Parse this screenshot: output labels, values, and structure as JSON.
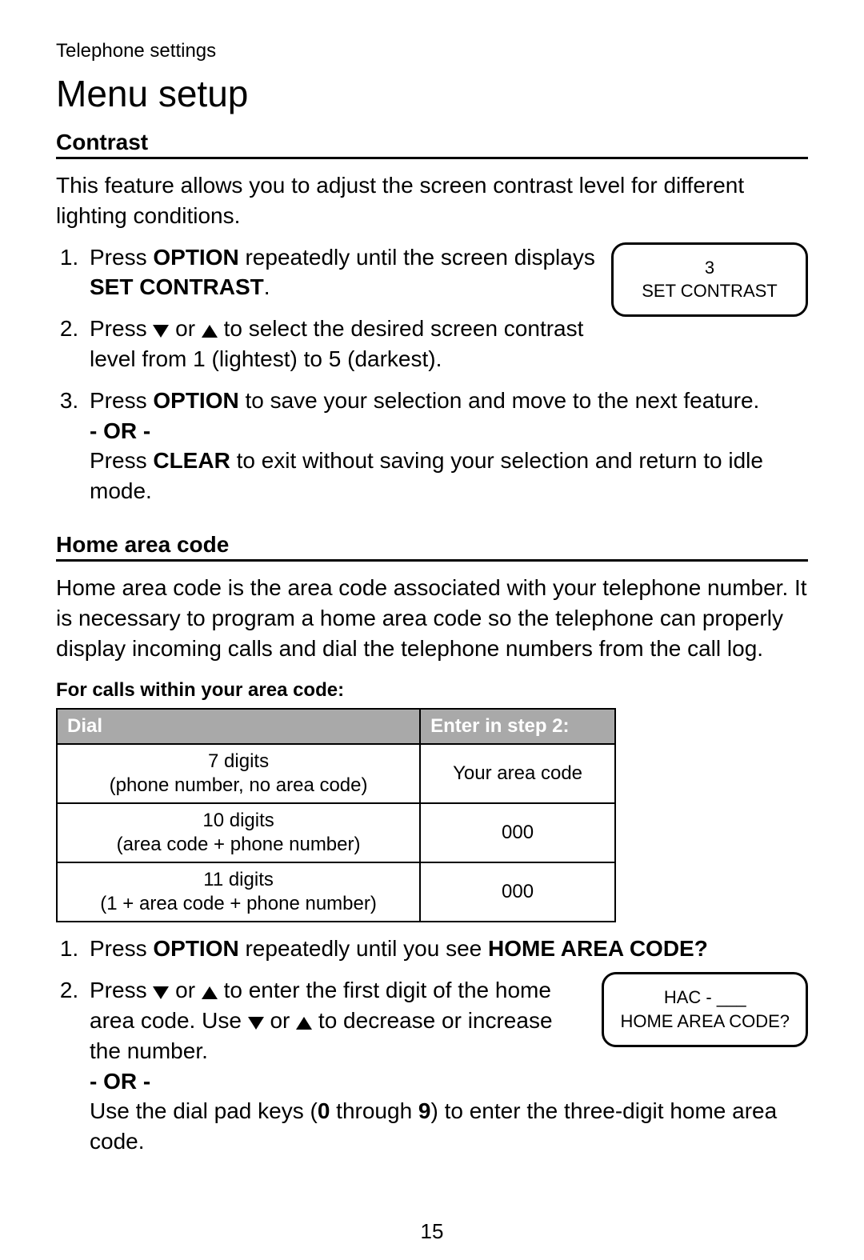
{
  "breadcrumb": "Telephone settings",
  "title": "Menu setup",
  "page_number": "15",
  "contrast": {
    "heading": "Contrast",
    "intro": "This feature allows you to adjust the screen contrast level for different lighting conditions.",
    "display": {
      "line1": "3",
      "line2": "SET CONTRAST"
    },
    "step1_a": "Press ",
    "step1_b": "OPTION",
    "step1_c": " repeatedly until the screen displays ",
    "step1_d": "SET CONTRAST",
    "step1_e": ".",
    "step2_a": "Press ",
    "step2_b": " or ",
    "step2_c": " to select the desired screen contrast level from 1 (lightest) to 5 (darkest).",
    "step3_a": "Press ",
    "step3_b": "OPTION",
    "step3_c": " to save your selection and move to the next feature.",
    "or": "- OR -",
    "step3_d": "Press ",
    "step3_e": "CLEAR",
    "step3_f": " to exit without saving your selection and return to idle mode."
  },
  "home": {
    "heading": "Home area code",
    "intro": "Home area code is the area code associated with your telephone number. It is necessary to program a home area code so the telephone can properly display incoming calls and dial the telephone numbers from the call log.",
    "sub": "For calls within your area code:",
    "table": {
      "headers": [
        "Dial",
        "Enter in step 2:"
      ],
      "rows": [
        {
          "c1a": "7 digits",
          "c1b": "(phone number, no area code)",
          "c2": "Your area code"
        },
        {
          "c1a": "10 digits",
          "c1b": "(area code + phone number)",
          "c2": "000"
        },
        {
          "c1a": "11 digits",
          "c1b": "(1 + area code + phone number)",
          "c2": "000"
        }
      ]
    },
    "display": {
      "line1": "HAC - ___",
      "line2": "HOME AREA CODE?"
    },
    "step1_a": "Press ",
    "step1_b": "OPTION",
    "step1_c": " repeatedly until you see ",
    "step1_d": "HOME AREA CODE?",
    "step2_a": "Press ",
    "step2_b": " or ",
    "step2_c": " to enter the first digit of the home area code. Use ",
    "step2_d": " or ",
    "step2_e": " to decrease or increase the number.",
    "or": "- OR -",
    "step2_f": "Use the dial pad keys (",
    "step2_g": "0",
    "step2_h": " through ",
    "step2_i": "9",
    "step2_j": ") to enter the three-digit home area code."
  }
}
